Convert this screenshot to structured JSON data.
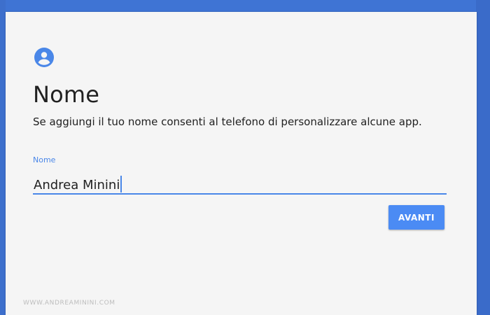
{
  "page": {
    "title": "Nome",
    "subtitle": "Se aggiungi il tuo nome consenti al telefono di personalizzare alcune app."
  },
  "name_field": {
    "label": "Nome",
    "value": "Andrea Minini"
  },
  "actions": {
    "next_label": "AVANTI"
  },
  "watermark": "WWW.ANDREAMININI.COM",
  "icons": {
    "header": "account-circle-icon"
  },
  "colors": {
    "accent": "#4a87e8",
    "button": "#4b8bf4",
    "background": "#3f74d4",
    "card": "#f5f5f5"
  }
}
